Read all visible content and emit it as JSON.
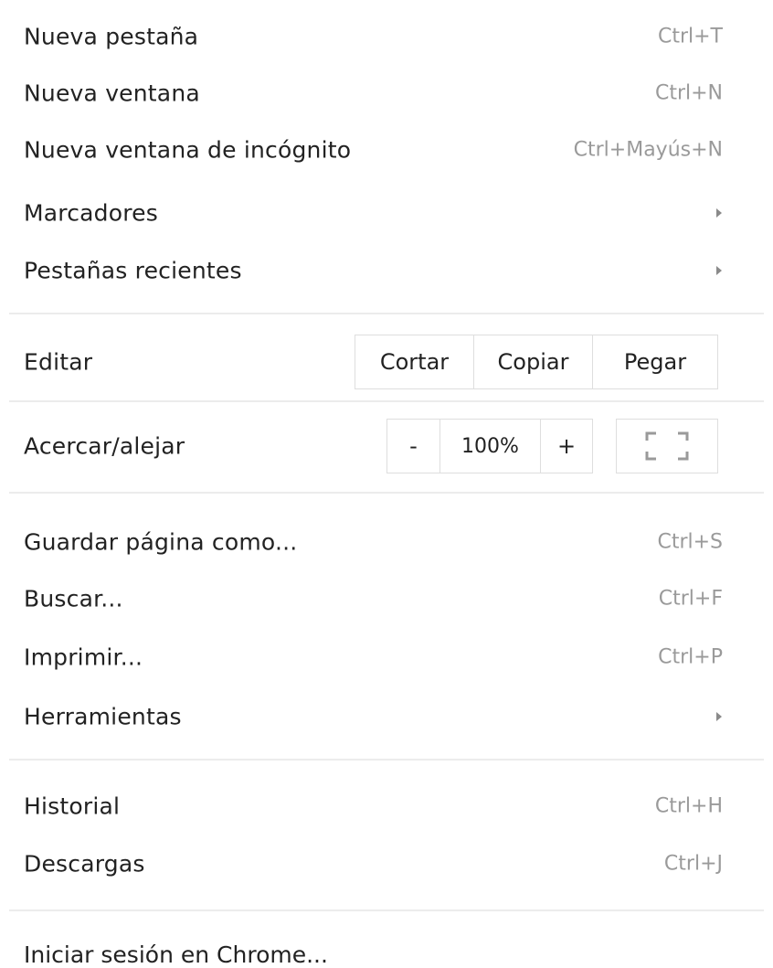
{
  "menu": {
    "group1": [
      {
        "label": "Nueva pestaña",
        "shortcut": "Ctrl+T"
      },
      {
        "label": "Nueva ventana",
        "shortcut": "Ctrl+N"
      },
      {
        "label": "Nueva ventana de incógnito",
        "shortcut": "Ctrl+Mayús+N"
      },
      {
        "label": "Marcadores",
        "submenu": true
      },
      {
        "label": "Pestañas recientes",
        "submenu": true
      }
    ],
    "edit": {
      "label": "Editar",
      "cut": "Cortar",
      "copy": "Copiar",
      "paste": "Pegar"
    },
    "zoom": {
      "label": "Acercar/alejar",
      "minus": "-",
      "value": "100%",
      "plus": "+",
      "fullscreen_icon": "fullscreen-icon"
    },
    "group2": [
      {
        "label": "Guardar página como...",
        "shortcut": "Ctrl+S"
      },
      {
        "label": "Buscar...",
        "shortcut": "Ctrl+F"
      },
      {
        "label": "Imprimir...",
        "shortcut": "Ctrl+P"
      },
      {
        "label": "Herramientas",
        "submenu": true
      }
    ],
    "group3": [
      {
        "label": "Historial",
        "shortcut": "Ctrl+H"
      },
      {
        "label": "Descargas",
        "shortcut": "Ctrl+J"
      }
    ],
    "signin": {
      "label": "Iniciar sesión en Chrome..."
    }
  },
  "colors": {
    "text": "#222222",
    "shortcut": "#9a9a9a",
    "separator": "#ececec",
    "border": "#dedede"
  }
}
